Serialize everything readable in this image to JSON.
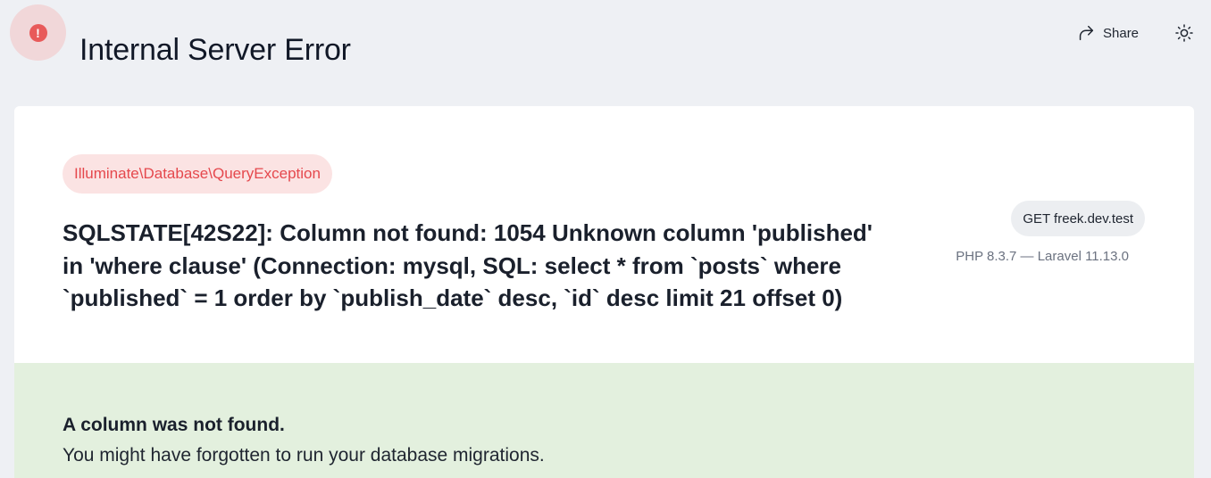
{
  "header": {
    "title": "Internal Server Error",
    "error_icon_glyph": "!",
    "share_label": "Share",
    "icons": {
      "error": "error-circle-icon",
      "share": "share-arrow-icon",
      "theme": "sun-icon"
    }
  },
  "exception": {
    "class_name": "Illuminate\\Database\\QueryException",
    "message": "SQLSTATE[42S22]: Column not found: 1054 Unknown column 'published' in 'where clause' (Connection: mysql, SQL: select * from `posts` where `published` = 1 order by `publish_date` desc, `id` desc limit 21 offset 0)"
  },
  "request": {
    "label": "GET freek.dev.test",
    "versions": "PHP 8.3.7 — Laravel 11.13.0"
  },
  "solution": {
    "title": "A column was not found.",
    "description": "You might have forgotten to run your database migrations."
  },
  "colors": {
    "error_red": "#e85a5a",
    "exception_text": "#e5484d",
    "solution_bg": "#e3f0de",
    "page_bg": "#eef0f4"
  }
}
